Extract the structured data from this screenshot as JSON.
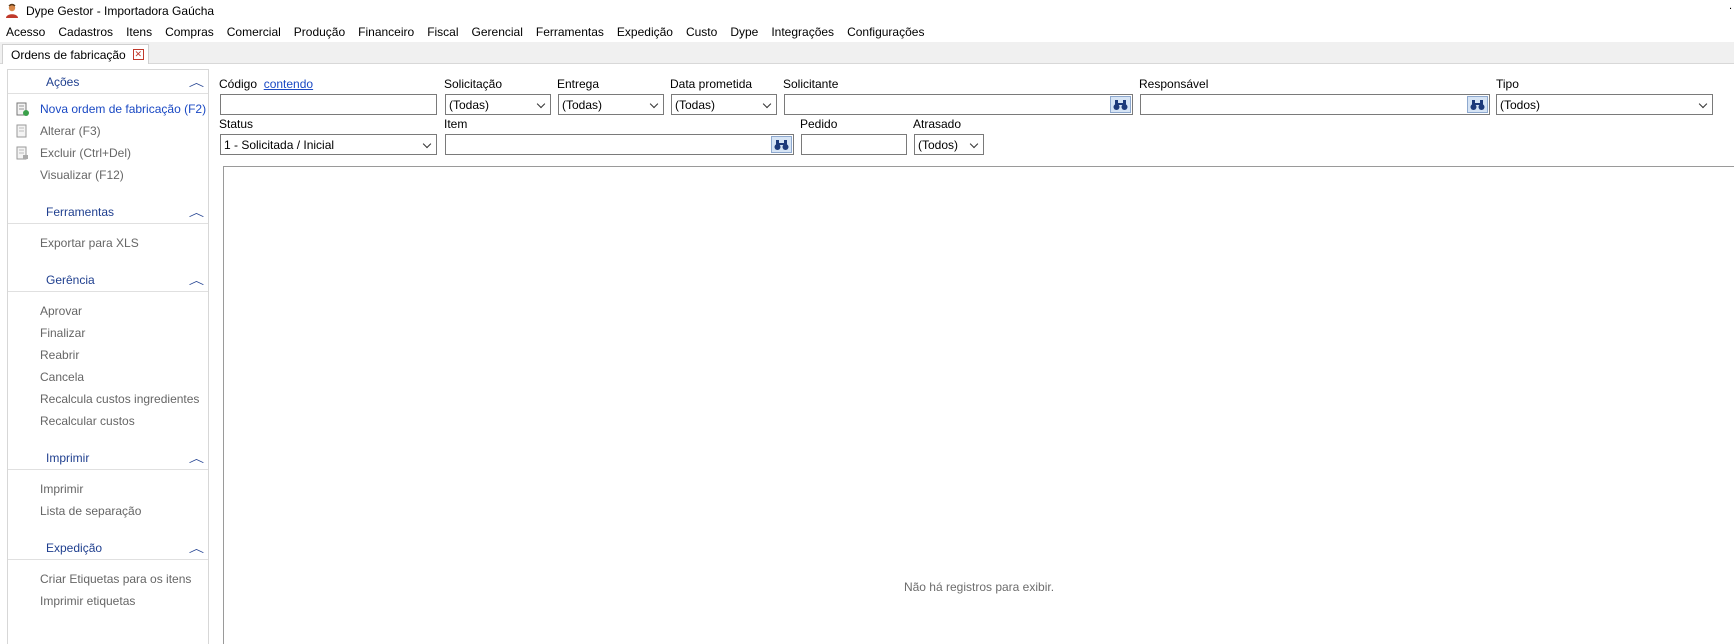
{
  "window": {
    "title": "Dype Gestor - Importadora Gaúcha",
    "app_icon": "person-user-icon",
    "corner_mark": "."
  },
  "menu": [
    {
      "label": "Acesso"
    },
    {
      "label": "Cadastros"
    },
    {
      "label": "Itens"
    },
    {
      "label": "Compras"
    },
    {
      "label": "Comercial"
    },
    {
      "label": "Produção"
    },
    {
      "label": "Financeiro"
    },
    {
      "label": "Fiscal"
    },
    {
      "label": "Gerencial"
    },
    {
      "label": "Ferramentas"
    },
    {
      "label": "Expedição"
    },
    {
      "label": "Custo"
    },
    {
      "label": "Dype"
    },
    {
      "label": "Integrações"
    },
    {
      "label": "Configurações"
    }
  ],
  "tab": {
    "label": "Ordens de fabricação",
    "close_icon": "close-icon",
    "close_color": "#c0392b"
  },
  "sidebar": {
    "accent_color": "#1f3f8f",
    "sections": [
      {
        "title": "Ações",
        "items": [
          {
            "label": "Nova ordem de fabricação (F2)",
            "enabled": true,
            "icon": "new-document-icon"
          },
          {
            "label": "Alterar (F3)",
            "enabled": false,
            "icon": "edit-document-icon"
          },
          {
            "label": "Excluir (Ctrl+Del)",
            "enabled": false,
            "icon": "delete-document-icon"
          },
          {
            "label": "Visualizar (F12)",
            "enabled": false
          }
        ]
      },
      {
        "title": "Ferramentas",
        "items": [
          {
            "label": "Exportar para XLS",
            "enabled": false
          }
        ]
      },
      {
        "title": "Gerência",
        "items": [
          {
            "label": "Aprovar",
            "enabled": false
          },
          {
            "label": "Finalizar",
            "enabled": false
          },
          {
            "label": "Reabrir",
            "enabled": false
          },
          {
            "label": "Cancela",
            "enabled": false
          },
          {
            "label": "Recalcula custos ingredientes",
            "enabled": false
          },
          {
            "label": "Recalcular custos",
            "enabled": false
          }
        ]
      },
      {
        "title": "Imprimir",
        "items": [
          {
            "label": "Imprimir",
            "enabled": false
          },
          {
            "label": "Lista de separação",
            "enabled": false
          }
        ]
      },
      {
        "title": "Expedição",
        "items": [
          {
            "label": "Criar Etiquetas para os itens",
            "enabled": false
          },
          {
            "label": "Imprimir etiquetas",
            "enabled": false
          }
        ]
      }
    ]
  },
  "filters": {
    "codigo": {
      "label": "Código",
      "link": "contendo",
      "value": ""
    },
    "solicitacao": {
      "label": "Solicitação",
      "value": "(Todas)"
    },
    "entrega": {
      "label": "Entrega",
      "value": "(Todas)"
    },
    "data_prometida": {
      "label": "Data prometida",
      "value": "(Todas)"
    },
    "solicitante": {
      "label": "Solicitante",
      "value": ""
    },
    "responsavel": {
      "label": "Responsável",
      "value": ""
    },
    "tipo": {
      "label": "Tipo",
      "value": "(Todos)"
    },
    "status": {
      "label": "Status",
      "value": "1 - Solicitada / Inicial"
    },
    "item": {
      "label": "Item",
      "value": ""
    },
    "pedido": {
      "label": "Pedido",
      "value": ""
    },
    "atrasado": {
      "label": "Atrasado",
      "value": "(Todos)"
    }
  },
  "grid": {
    "empty_message": "Não há registros para exibir."
  }
}
